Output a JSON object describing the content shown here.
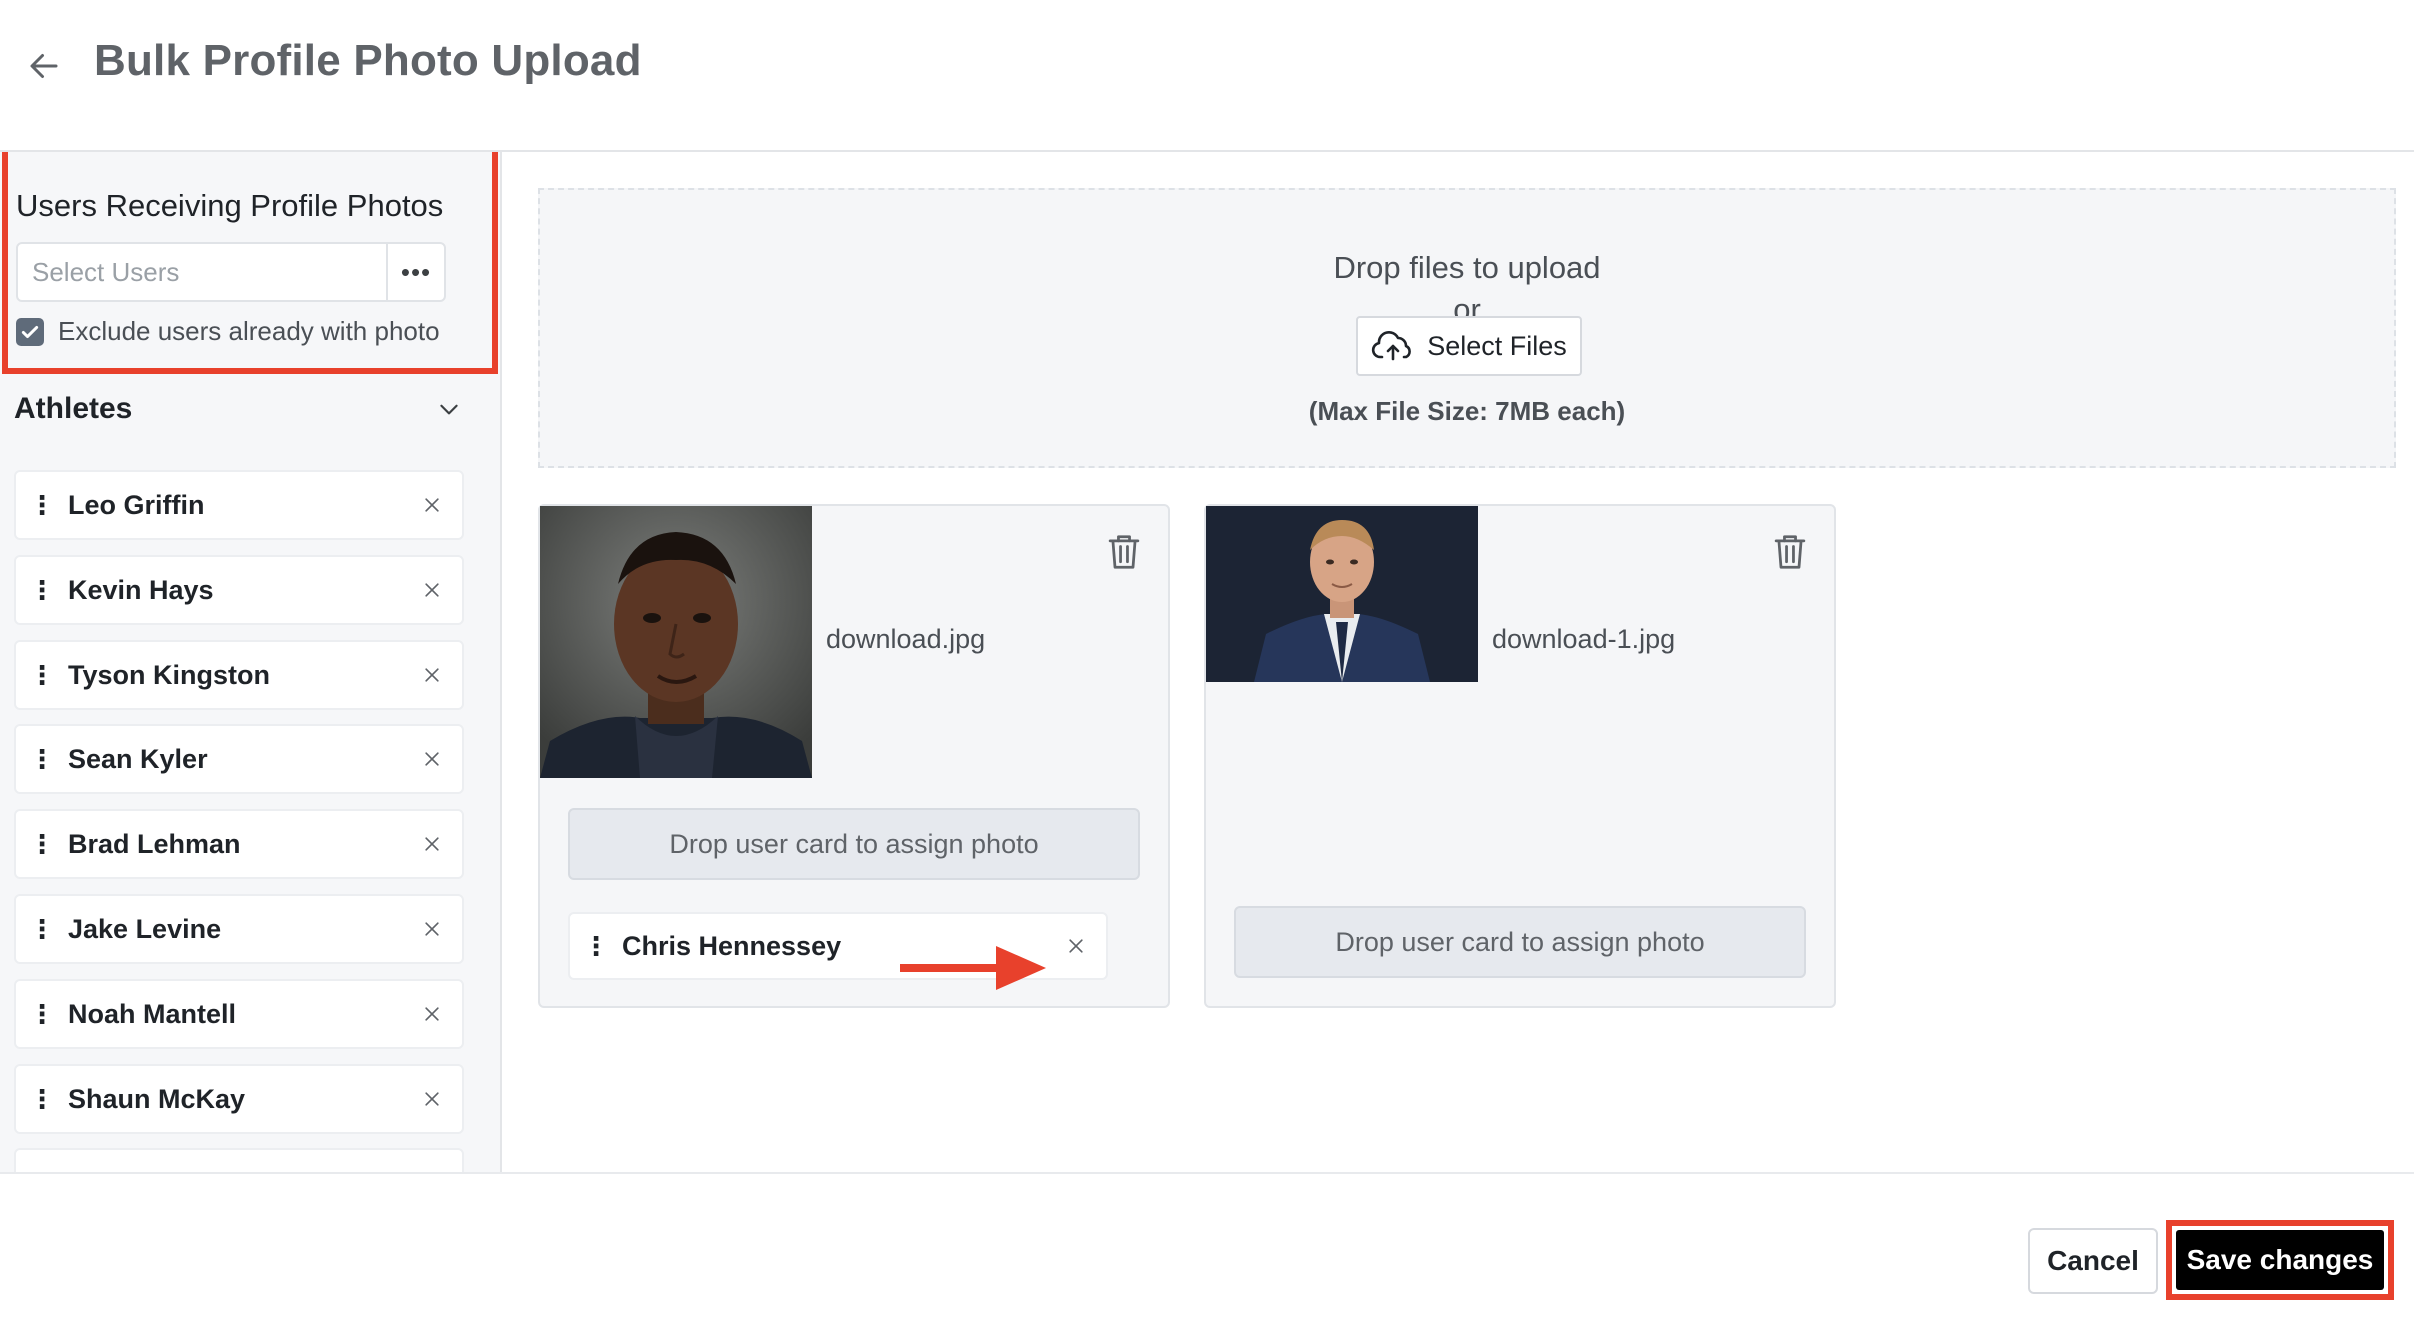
{
  "header": {
    "title": "Bulk Profile Photo Upload"
  },
  "sidebar": {
    "users_title": "Users Receiving Profile Photos",
    "select_placeholder": "Select Users",
    "more_label": "•••",
    "exclude_label": "Exclude users already with photo",
    "exclude_checked": true,
    "group_title": "Athletes",
    "users": [
      {
        "name": "Leo Griffin"
      },
      {
        "name": "Kevin Hays"
      },
      {
        "name": "Tyson Kingston"
      },
      {
        "name": "Sean Kyler"
      },
      {
        "name": "Brad Lehman"
      },
      {
        "name": "Jake Levine"
      },
      {
        "name": "Noah Mantell"
      },
      {
        "name": "Shaun McKay"
      }
    ]
  },
  "dropzone": {
    "title": "Drop files to upload",
    "or": "or",
    "select_files": "Select Files",
    "max_size": "(Max File Size: 7MB each)"
  },
  "photos": [
    {
      "file_name": "download.jpg",
      "drop_label": "Drop user card to assign photo",
      "assigned_user": "Chris Hennessey"
    },
    {
      "file_name": "download-1.jpg",
      "drop_label": "Drop user card to assign photo",
      "assigned_user": null
    }
  ],
  "footer": {
    "cancel": "Cancel",
    "save": "Save changes"
  },
  "colors": {
    "highlight": "#e8412c",
    "primary_button": "#000000"
  }
}
